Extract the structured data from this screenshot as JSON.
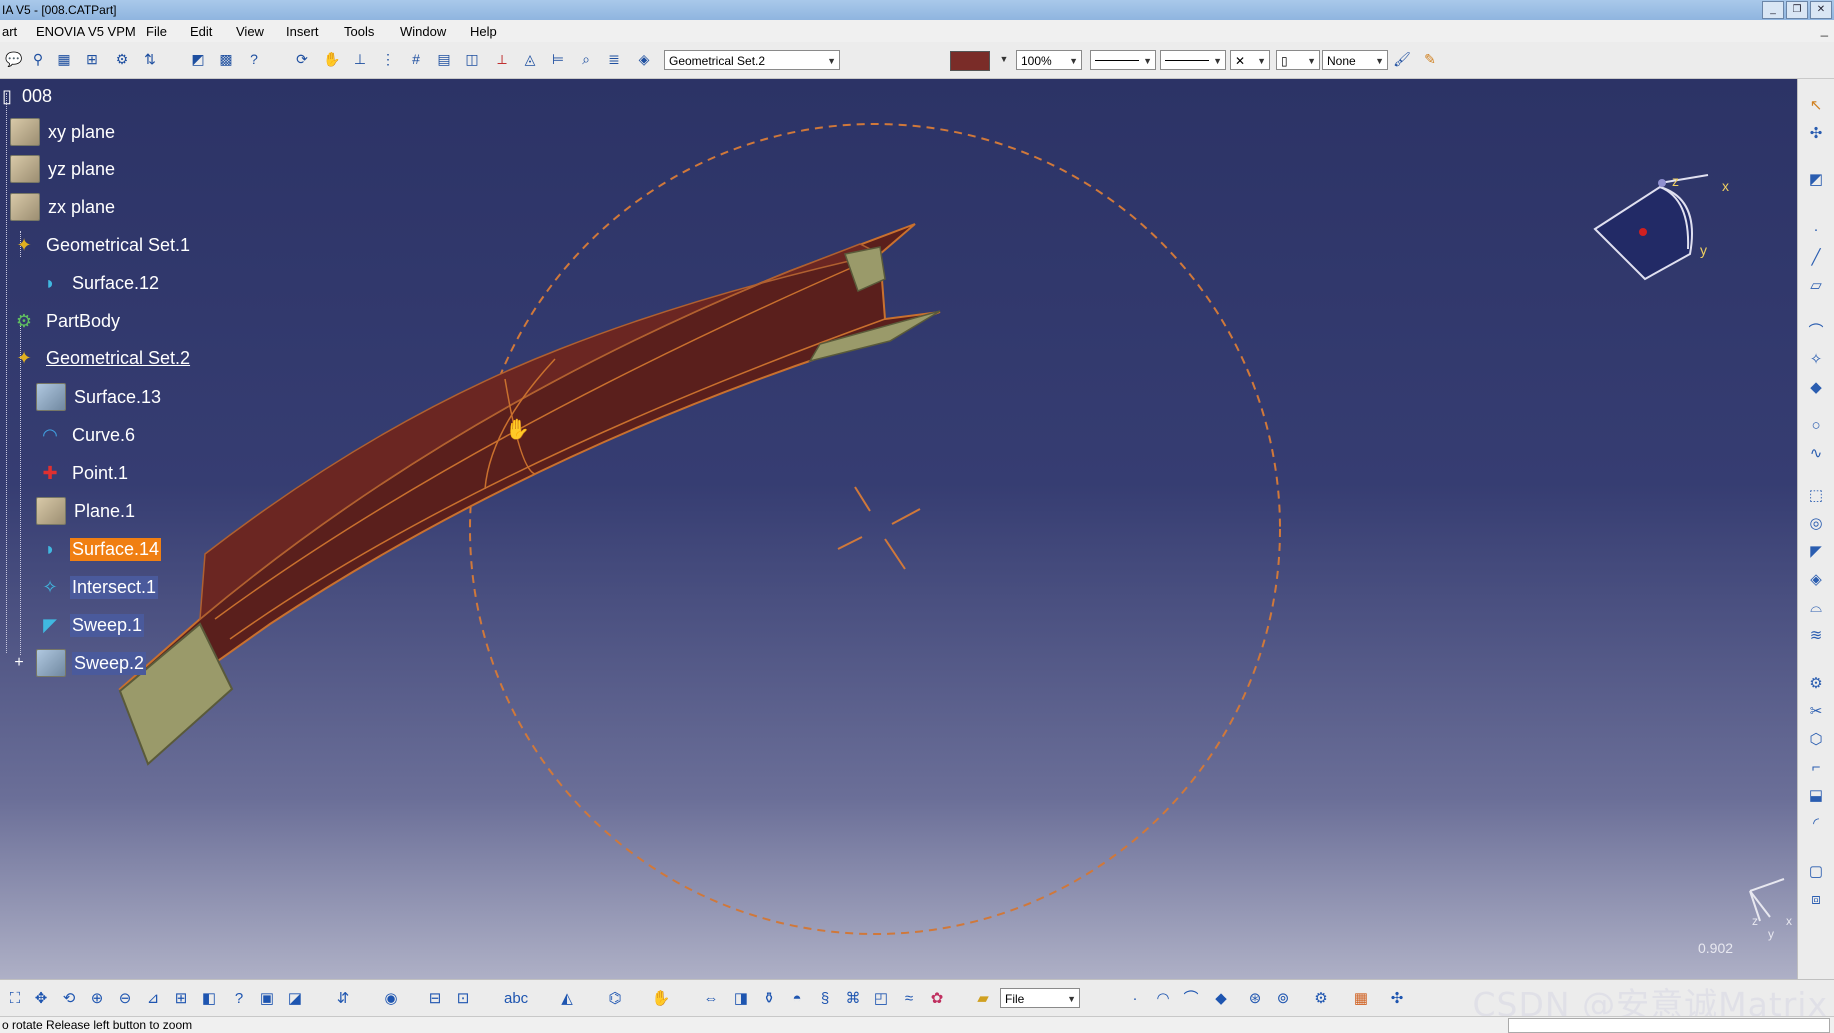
{
  "window": {
    "title": "IA V5 - [008.CATPart]",
    "controls": [
      "_",
      "❐",
      "✕"
    ]
  },
  "menu": {
    "items": [
      "art",
      "ENOVIA V5 VPM",
      "File",
      "Edit",
      "View",
      "Insert",
      "Tools",
      "Window",
      "Help"
    ],
    "right_control": "_"
  },
  "toolbar": {
    "geom_set_combo": "Geometrical Set.2",
    "color": "#7a2c28",
    "zoom_combo": "100%",
    "layer_combo": "None"
  },
  "tree": {
    "root": "008",
    "items": [
      {
        "label": "xy plane",
        "icon": "plane-icon"
      },
      {
        "label": "yz plane",
        "icon": "plane-icon"
      },
      {
        "label": "zx plane",
        "icon": "plane-icon"
      },
      {
        "label": "Geometrical Set.1",
        "icon": "geometrical-set-icon"
      },
      {
        "label": "Surface.12",
        "icon": "surface-icon"
      },
      {
        "label": "PartBody",
        "icon": "partbody-icon"
      },
      {
        "label": "Geometrical Set.2",
        "icon": "geometrical-set-icon"
      },
      {
        "label": "Surface.13",
        "icon": "surface-icon"
      },
      {
        "label": "Curve.6",
        "icon": "curve-icon"
      },
      {
        "label": "Point.1",
        "icon": "point-icon"
      },
      {
        "label": "Plane.1",
        "icon": "plane-icon"
      },
      {
        "label": "Surface.14",
        "icon": "surface-icon"
      },
      {
        "label": "Intersect.1",
        "icon": "intersect-icon"
      },
      {
        "label": "Sweep.1",
        "icon": "sweep-icon"
      },
      {
        "label": "Sweep.2",
        "icon": "sweep-icon"
      }
    ],
    "selected": "Surface.14"
  },
  "viewport": {
    "compass_labels": {
      "x": "x",
      "y": "y",
      "z": "z"
    },
    "axis_labels": {
      "x": "x",
      "y": "y",
      "z": "z"
    },
    "scale_value": "0.902",
    "colors": {
      "body": "#5a1f1c",
      "edge": "#c9702e",
      "circle": "#d0783a",
      "end_face": "#9a9a6a"
    }
  },
  "bottom_toolbar": {
    "file_combo": "File"
  },
  "status": {
    "message": "o rotate   Release left button to zoom"
  },
  "watermark": "CSDN @安意诚Matrix"
}
